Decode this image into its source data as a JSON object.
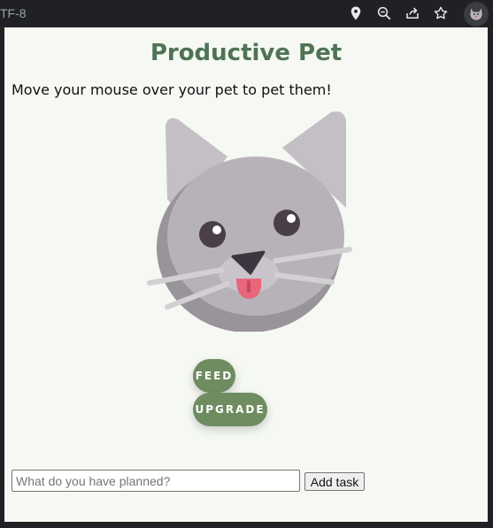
{
  "browser": {
    "url_fragment": "TF-8",
    "icons": [
      "location-icon",
      "zoom-out-icon",
      "share-icon",
      "bookmark-star-icon",
      "extension-cat-icon"
    ]
  },
  "popup": {
    "title": "Productive Pet",
    "instruction": "Move your mouse over your pet to pet them!",
    "pet_icon": "cat-face",
    "buttons": {
      "feed_label": "FEED",
      "upgrade_label": "UPGRADE"
    },
    "task": {
      "placeholder": "What do you have planned?",
      "value": "",
      "add_label": "Add task"
    }
  },
  "colors": {
    "accent": "#6f8c61",
    "title": "#4f7355",
    "background": "#f5f8f3",
    "browser_chrome": "#202124"
  }
}
